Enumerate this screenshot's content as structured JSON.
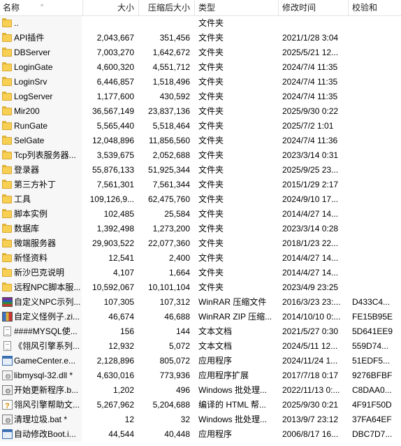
{
  "columns": {
    "name": "名称",
    "size": "大小",
    "compressed": "压缩后大小",
    "type": "类型",
    "modified": "修改时间",
    "crc": "校验和"
  },
  "rows": [
    {
      "icon": "folder-icon",
      "name": "..",
      "size": "",
      "csize": "",
      "type": "文件夹",
      "date": "",
      "crc": ""
    },
    {
      "icon": "folder-icon",
      "name": "API插件",
      "size": "2,043,667",
      "csize": "351,456",
      "type": "文件夹",
      "date": "2021/1/28 3:04",
      "crc": ""
    },
    {
      "icon": "folder-icon",
      "name": "DBServer",
      "size": "7,003,270",
      "csize": "1,642,672",
      "type": "文件夹",
      "date": "2025/5/21 12...",
      "crc": ""
    },
    {
      "icon": "folder-icon",
      "name": "LoginGate",
      "size": "4,600,320",
      "csize": "4,551,712",
      "type": "文件夹",
      "date": "2024/7/4 11:35",
      "crc": ""
    },
    {
      "icon": "folder-icon",
      "name": "LoginSrv",
      "size": "6,446,857",
      "csize": "1,518,496",
      "type": "文件夹",
      "date": "2024/7/4 11:35",
      "crc": ""
    },
    {
      "icon": "folder-icon",
      "name": "LogServer",
      "size": "1,177,600",
      "csize": "430,592",
      "type": "文件夹",
      "date": "2024/7/4 11:35",
      "crc": ""
    },
    {
      "icon": "folder-icon",
      "name": "Mir200",
      "size": "36,567,149",
      "csize": "23,837,136",
      "type": "文件夹",
      "date": "2025/9/30 0:22",
      "crc": ""
    },
    {
      "icon": "folder-icon",
      "name": "RunGate",
      "size": "5,565,440",
      "csize": "5,518,464",
      "type": "文件夹",
      "date": "2025/7/2 1:01",
      "crc": ""
    },
    {
      "icon": "folder-icon",
      "name": "SelGate",
      "size": "12,048,896",
      "csize": "11,856,560",
      "type": "文件夹",
      "date": "2024/7/4 11:36",
      "crc": ""
    },
    {
      "icon": "folder-icon",
      "name": "Tcp列表服务器...",
      "size": "3,539,675",
      "csize": "2,052,688",
      "type": "文件夹",
      "date": "2023/3/14 0:31",
      "crc": ""
    },
    {
      "icon": "folder-icon",
      "name": "登录器",
      "size": "55,876,133",
      "csize": "51,925,344",
      "type": "文件夹",
      "date": "2025/9/25 23...",
      "crc": ""
    },
    {
      "icon": "folder-icon",
      "name": "第三方补丁",
      "size": "7,561,301",
      "csize": "7,561,344",
      "type": "文件夹",
      "date": "2015/1/29 2:17",
      "crc": ""
    },
    {
      "icon": "folder-icon",
      "name": "工具",
      "size": "109,126,9...",
      "csize": "62,475,760",
      "type": "文件夹",
      "date": "2024/9/10 17...",
      "crc": ""
    },
    {
      "icon": "folder-icon",
      "name": "脚本实例",
      "size": "102,485",
      "csize": "25,584",
      "type": "文件夹",
      "date": "2014/4/27 14...",
      "crc": ""
    },
    {
      "icon": "folder-icon",
      "name": "数据库",
      "size": "1,392,498",
      "csize": "1,273,200",
      "type": "文件夹",
      "date": "2023/3/14 0:28",
      "crc": ""
    },
    {
      "icon": "folder-icon",
      "name": "微端服务器",
      "size": "29,903,522",
      "csize": "22,077,360",
      "type": "文件夹",
      "date": "2018/1/23 22...",
      "crc": ""
    },
    {
      "icon": "folder-icon",
      "name": "新怪资料",
      "size": "12,541",
      "csize": "2,400",
      "type": "文件夹",
      "date": "2014/4/27 14...",
      "crc": ""
    },
    {
      "icon": "folder-icon",
      "name": "新沙巴克说明",
      "size": "4,107",
      "csize": "1,664",
      "type": "文件夹",
      "date": "2014/4/27 14...",
      "crc": ""
    },
    {
      "icon": "folder-icon",
      "name": "远程NPC脚本服...",
      "size": "10,592,067",
      "csize": "10,101,104",
      "type": "文件夹",
      "date": "2023/4/9 23:25",
      "crc": ""
    },
    {
      "icon": "rar-archive-icon",
      "name": "自定义NPC示列...",
      "size": "107,305",
      "csize": "107,312",
      "type": "WinRAR 压缩文件",
      "date": "2016/3/23 23:...",
      "crc": "D433C4..."
    },
    {
      "icon": "zip-archive-icon",
      "name": "自定义怪例子.zi...",
      "size": "46,674",
      "csize": "46,688",
      "type": "WinRAR ZIP 压缩...",
      "date": "2014/10/10 0:...",
      "crc": "FE15B95E"
    },
    {
      "icon": "text-document-icon",
      "name": "####MYSQL使...",
      "size": "156",
      "csize": "144",
      "type": "文本文档",
      "date": "2021/5/27 0:30",
      "crc": "5D641EE9"
    },
    {
      "icon": "text-document-icon",
      "name": "《翎风引擎系列...",
      "size": "12,932",
      "csize": "5,072",
      "type": "文本文档",
      "date": "2024/5/11 12...",
      "crc": "559D74..."
    },
    {
      "icon": "application-icon",
      "name": "GameCenter.e...",
      "size": "2,128,896",
      "csize": "805,072",
      "type": "应用程序",
      "date": "2024/11/24 1...",
      "crc": "51EDF5..."
    },
    {
      "icon": "dll-extension-icon",
      "name": "libmysql-32.dll *",
      "size": "4,630,016",
      "csize": "773,936",
      "type": "应用程序扩展",
      "date": "2017/7/18 0:17",
      "crc": "9276BFBF"
    },
    {
      "icon": "batch-file-icon",
      "name": "开始更新程序.b...",
      "size": "1,202",
      "csize": "496",
      "type": "Windows 批处理...",
      "date": "2022/11/13 0:...",
      "crc": "C8DAA0..."
    },
    {
      "icon": "chm-help-icon",
      "name": "翎风引擎帮助文...",
      "size": "5,267,962",
      "csize": "5,204,688",
      "type": "编译的 HTML 帮...",
      "date": "2025/9/30 0:21",
      "crc": "4F91F50D"
    },
    {
      "icon": "batch-file-icon",
      "name": "清理垃圾.bat *",
      "size": "12",
      "csize": "32",
      "type": "Windows 批处理...",
      "date": "2013/9/7 23:12",
      "crc": "37FA64EF"
    },
    {
      "icon": "application-icon",
      "name": "自动修改Boot.i...",
      "size": "44,544",
      "csize": "40,448",
      "type": "应用程序",
      "date": "2006/8/17 16...",
      "crc": "DBC7D7..."
    }
  ]
}
